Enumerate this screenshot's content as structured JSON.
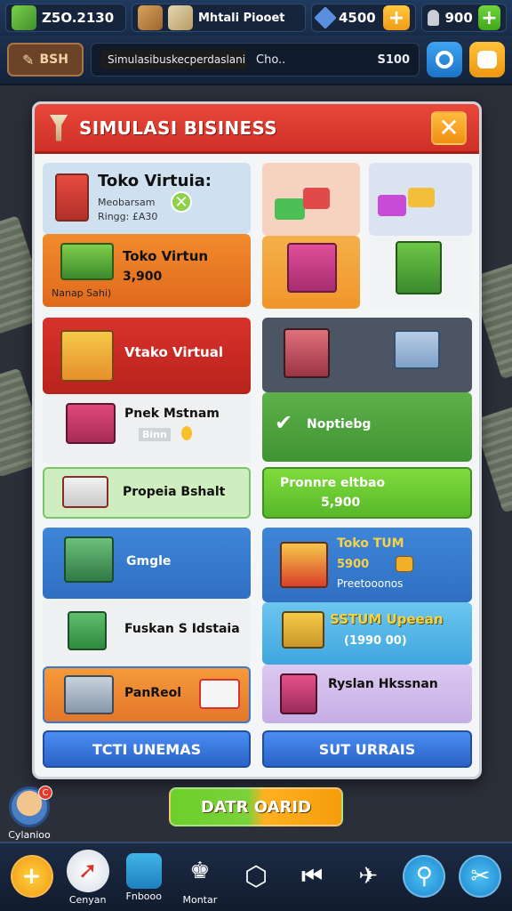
{
  "topbar": {
    "resource1": "Z5O.2130",
    "resource2_label": "Mhtali Piooet",
    "resource3": "4500",
    "resource4": "900"
  },
  "subbar": {
    "chip_label": "BSH",
    "ticker": "Simulasibuskecperdaslani",
    "news_text": "Cho..",
    "news_amount": "S100"
  },
  "modal": {
    "title": "SIMULASI BISINESS",
    "tiles": {
      "t1_title": "Toko Virtuia:",
      "t1_line1": "Meobarsam",
      "t1_line2": "Ringg: £A30",
      "t2_title": "Toko Virtun",
      "t2_price": "3,900",
      "t2_sub": "Nanap Sahi)",
      "t3_title": "Vtako Virtual",
      "t4_title": "Pnek Mstnam",
      "t4_sub": "Binn",
      "t5_title": "Noptiebg",
      "t6_title": "Propeia Bshalt",
      "t7_title": "Pronnre eltbao",
      "t7_price": "5,900",
      "t8_title": "Gmgle",
      "t9_title": "Toko TUM",
      "t9_price": "5900",
      "t9_sub": "Preetooonos",
      "t10_title": "Fuskan S Idstaia",
      "t11_title": "SSTUM Upeean",
      "t11_price": "(1990 00)",
      "t12_title": "PanReol",
      "t13_title": "Ryslan Hkssnan"
    },
    "btn_left": "TCTI UNEMAS",
    "btn_right": "SUT URRAIS"
  },
  "cta_label": "DATR OARID",
  "avatar_label": "Cylanioo",
  "avatar_badge": "C",
  "nav": [
    "Cenyan",
    "Fnbooo",
    "Montar",
    "",
    "",
    "",
    "",
    ""
  ]
}
